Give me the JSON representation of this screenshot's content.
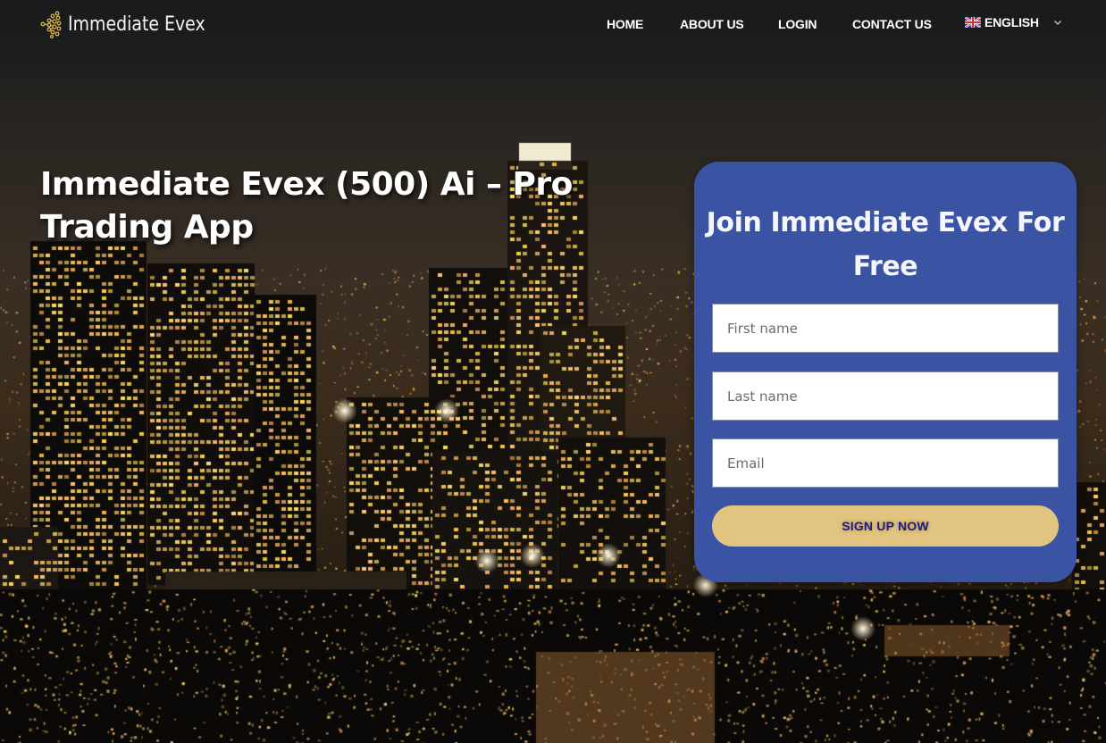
{
  "header": {
    "logo_text": "Immediate Evex",
    "logo_icon": "globe-dots-icon",
    "nav": [
      {
        "label": "HOME"
      },
      {
        "label": "ABOUT US"
      },
      {
        "label": "LOGIN"
      },
      {
        "label": "CONTACT US"
      }
    ],
    "language": {
      "label": "ENGLISH",
      "flag_icon": "uk-flag-icon",
      "dropdown_icon": "chevron-down-icon"
    }
  },
  "hero": {
    "title": "Immediate Evex (500) Ai – Pro Trading App"
  },
  "signup": {
    "title": "Join Immediate Evex For Free",
    "fields": {
      "first_name": {
        "placeholder": "First name",
        "value": ""
      },
      "last_name": {
        "placeholder": "Last name",
        "value": ""
      },
      "email": {
        "placeholder": "Email",
        "value": ""
      }
    },
    "submit_label": "SIGN UP NOW"
  },
  "colors": {
    "card_bg": "#3b53a3",
    "button_bg": "#e1c47f",
    "button_text": "#1c1a8e",
    "logo_gold": "#d9b24a"
  }
}
